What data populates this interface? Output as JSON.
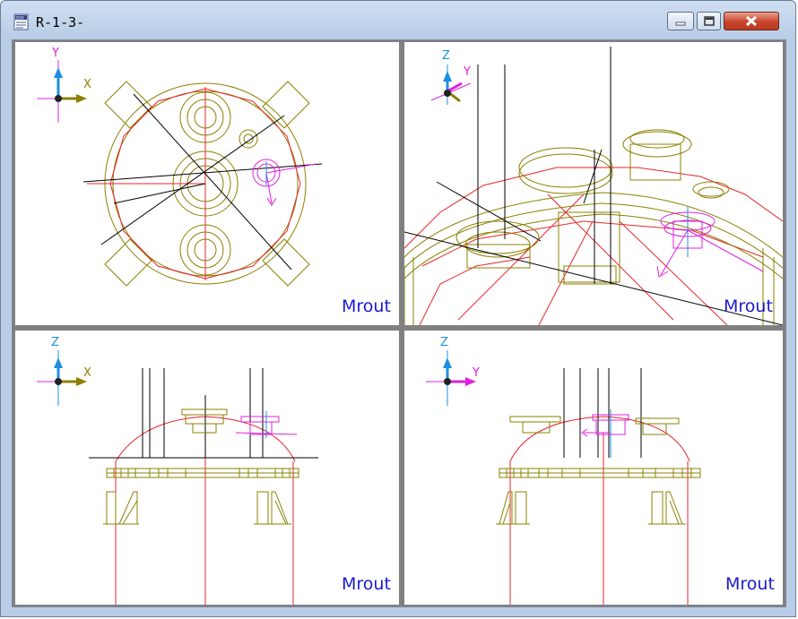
{
  "window": {
    "title": "R-1-3-",
    "app_icon": "document-icon",
    "controls": {
      "minimize": "minimize-icon",
      "maximize": "maximize-icon",
      "close": "close-icon"
    }
  },
  "viewports": {
    "top": {
      "label": "Mrout",
      "axis_h": "X",
      "axis_v": "Y"
    },
    "iso": {
      "label": "Mrout",
      "axis_h": "Y",
      "axis_v": "Z"
    },
    "front": {
      "label": "Mrout",
      "axis_h": "X",
      "axis_v": "Z"
    },
    "side": {
      "label": "Mrout",
      "axis_h": "Y",
      "axis_v": "Z"
    }
  },
  "colors": {
    "vessel": "#8b8000",
    "outline": "#e8262a",
    "nozzle": "#e020e0",
    "line": "#000000",
    "axis_blue": "#1e8fe0",
    "label": "#1a1acc"
  }
}
